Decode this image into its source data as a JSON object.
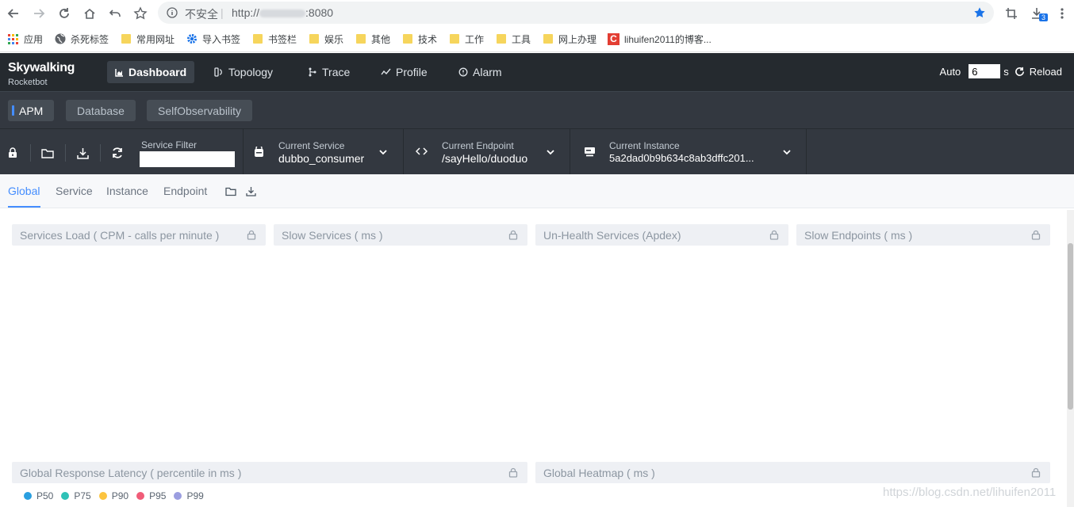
{
  "browser": {
    "security_label": "不安全",
    "url_prefix": "http://",
    "url_suffix": ":8080",
    "downloads_badge": "3"
  },
  "bookmarks": [
    {
      "label": "应用"
    },
    {
      "label": "杀死标签"
    },
    {
      "label": "常用网址"
    },
    {
      "label": "导入书签"
    },
    {
      "label": "书签栏"
    },
    {
      "label": "娱乐"
    },
    {
      "label": "其他"
    },
    {
      "label": "技术"
    },
    {
      "label": "工作"
    },
    {
      "label": "工具"
    },
    {
      "label": "网上办理"
    },
    {
      "label": "lihuifen2011的博客..."
    }
  ],
  "header": {
    "logo_top": "Skywalking",
    "logo_bottom": "Rocketbot",
    "nav": [
      {
        "label": "Dashboard"
      },
      {
        "label": "Topology"
      },
      {
        "label": "Trace"
      },
      {
        "label": "Profile"
      },
      {
        "label": "Alarm"
      }
    ],
    "auto_label": "Auto",
    "auto_value": "6",
    "auto_unit": "s",
    "reload_label": "Reload"
  },
  "groups": [
    {
      "label": "APM"
    },
    {
      "label": "Database"
    },
    {
      "label": "SelfObservability"
    }
  ],
  "toolbar": {
    "service_filter_label": "Service Filter",
    "service_filter_value": "",
    "current_service_label": "Current Service",
    "current_service_value": "dubbo_consumer",
    "current_endpoint_label": "Current Endpoint",
    "current_endpoint_value": "/sayHello/duoduo",
    "current_instance_label": "Current Instance",
    "current_instance_value": "5a2dad0b9b634c8ab3dffc201..."
  },
  "dash_tabs": [
    {
      "label": "Global"
    },
    {
      "label": "Service"
    },
    {
      "label": "Instance"
    },
    {
      "label": "Endpoint"
    }
  ],
  "panels": [
    {
      "title": "Services Load ( CPM - calls per minute )"
    },
    {
      "title": "Slow Services ( ms )"
    },
    {
      "title": "Un-Health Services (Apdex)"
    },
    {
      "title": "Slow Endpoints ( ms )"
    },
    {
      "title": "Global Response Latency ( percentile in ms )"
    },
    {
      "title": "Global Heatmap ( ms )"
    }
  ],
  "legend": [
    {
      "label": "P50",
      "color": "#2a9fe0"
    },
    {
      "label": "P75",
      "color": "#2fc2b7"
    },
    {
      "label": "P90",
      "color": "#fcc43f"
    },
    {
      "label": "P95",
      "color": "#f05c78"
    },
    {
      "label": "P99",
      "color": "#9b9ee0"
    }
  ],
  "watermark": "https://blog.csdn.net/lihuifen2011"
}
